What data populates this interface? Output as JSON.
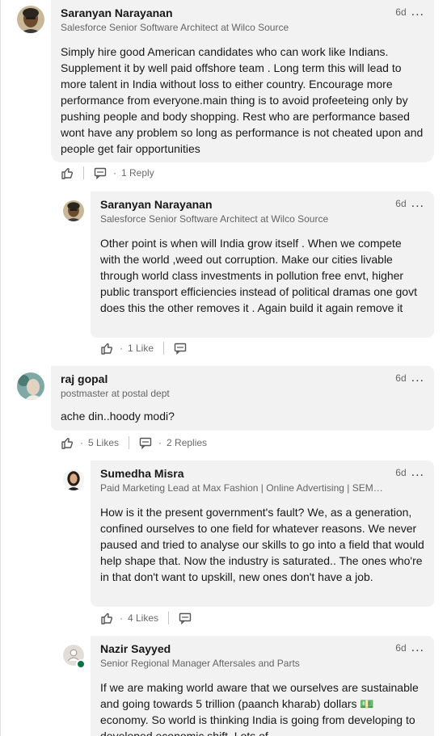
{
  "comments": [
    {
      "name": "Saranyan Narayanan",
      "headline": "Salesforce Senior Software Architect at Wilco Source",
      "time": "6d",
      "more": "...",
      "body": "Simply hire good American candidates who can work like Indians. Supplement it by well paid offshore team . Long term this will lead to more talent in India without loss to either country. Encourage more performance from everyone.main thing is to avoid profeeteing only by pushing people and body shopping. Rest who are performance based wont have any problem so long as performance is not cheated upon and people get fair opportunities",
      "reply_count": "1 Reply",
      "dot": "·"
    },
    {
      "name": "Saranyan Narayanan",
      "headline": "Salesforce Senior Software Architect at Wilco Source",
      "time": "6d",
      "more": "...",
      "body": "Other point is when will India grow itself . When we compete with the world ,weed out corruption.  Make our cities livable through world class investments in pollution free envt, higher public transport efficiencies instead of political dramas one govt does this the other removes it . Again build it again remove it",
      "like_count": "1 Like",
      "dot": "·"
    },
    {
      "name": "raj gopal",
      "headline": "postmaster at postal dept",
      "time": "6d",
      "more": "...",
      "body": "ache din..hoody modi?",
      "like_count": "5 Likes",
      "reply_count": "2 Replies",
      "dot": "·"
    },
    {
      "name": "Sumedha Misra",
      "headline": "Paid Marketing Lead at Max Fashion | Online Advertising | SEM…",
      "time": "6d",
      "more": "...",
      "body": "How is it the present government's fault? We, as a generation, confined ourselves to one field for whatever reasons. We never paused and tried to analyse our skills to go into a field that would help shape that. Now the industry is saturated.. The ones who're in that don't want to upskill, new ones don't have a job.",
      "like_count": "4 Likes",
      "dot": "·"
    },
    {
      "name": "Nazir Sayyed",
      "headline": "Senior Regional Manager Aftersales and Parts",
      "time": "6d",
      "more": "...",
      "body": "If we are making world aware that we ourselves are sustainable and going towards 5 trillion (paanch kharab) dollars 💵 economy. So world is thinking India is going from developing to developed economic shift. Lots of"
    }
  ],
  "colors": {
    "bubble_bg": "#f2f2f2",
    "online": "#057642",
    "muted": "#00000099"
  },
  "icons": {
    "like": "thumbs-up-icon",
    "reply": "comment-icon",
    "more": "more-dots-icon"
  }
}
